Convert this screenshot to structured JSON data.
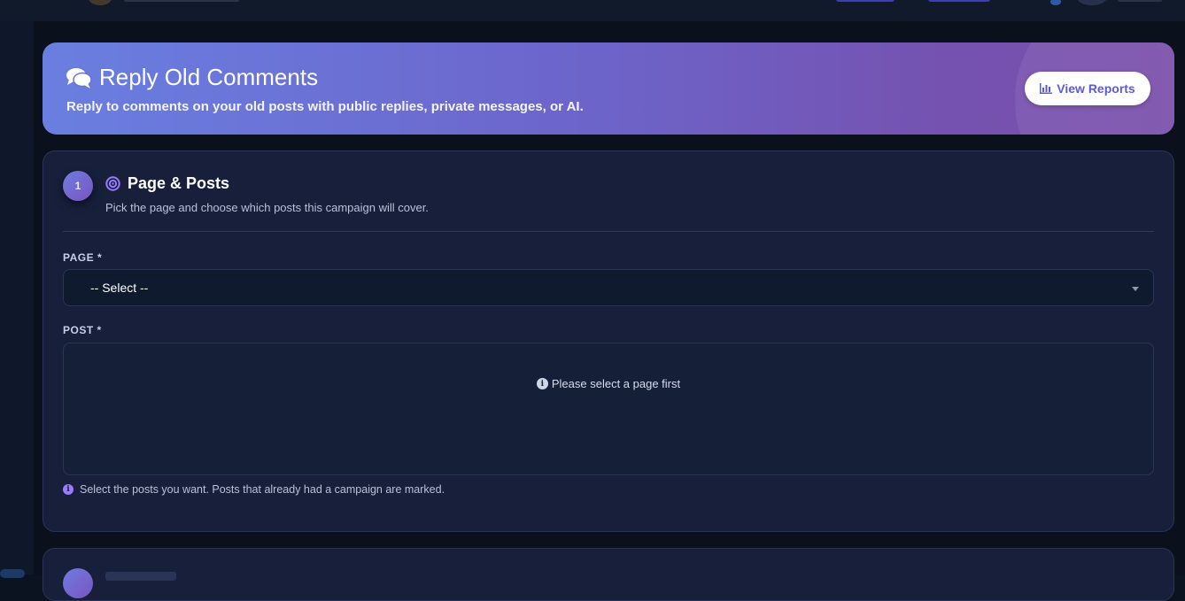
{
  "header": {
    "title": "Reply Old Comments",
    "subtitle": "Reply to comments on your old posts with public replies, private messages, or AI.",
    "title_icon": "comments-icon",
    "report_button_label": "View Reports",
    "report_button_icon": "bar-chart-icon"
  },
  "step1": {
    "number": "1",
    "icon": "bullseye-icon",
    "title": "Page & Posts",
    "description": "Pick the page and choose which posts this campaign will cover.",
    "page_label": "PAGE *",
    "page_value": "-- Select --",
    "post_label": "POST *",
    "post_empty_text": "Please select a page first",
    "hint": "Select the posts you want. Posts that already had a campaign are marked."
  },
  "colors": {
    "accent": "#7c5cff",
    "hero_start": "#6a7fe0",
    "hero_end": "#7a4fab",
    "card_bg": "#171f3b"
  }
}
